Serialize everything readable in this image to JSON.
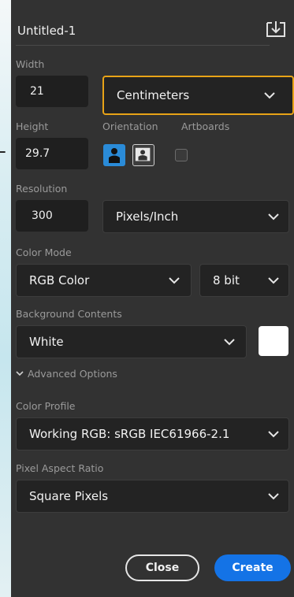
{
  "document": {
    "title": "Untitled-1",
    "save_icon": "save-preset-icon"
  },
  "width": {
    "label": "Width",
    "value": "21",
    "unit": "Centimeters"
  },
  "height": {
    "label": "Height",
    "value": "29.7"
  },
  "orientation": {
    "label": "Orientation",
    "selected": "portrait"
  },
  "artboards": {
    "label": "Artboards",
    "checked": false
  },
  "resolution": {
    "label": "Resolution",
    "value": "300",
    "unit": "Pixels/Inch"
  },
  "color_mode": {
    "label": "Color Mode",
    "mode": "RGB Color",
    "depth": "8 bit"
  },
  "background_contents": {
    "label": "Background Contents",
    "value": "White",
    "swatch_color": "#ffffff"
  },
  "advanced": {
    "label": "Advanced Options",
    "expanded": true
  },
  "color_profile": {
    "label": "Color Profile",
    "value": "Working RGB: sRGB IEC61966-2.1"
  },
  "pixel_aspect": {
    "label": "Pixel Aspect Ratio",
    "value": "Square Pixels"
  },
  "buttons": {
    "close": "Close",
    "create": "Create"
  },
  "colors": {
    "accent": "#1473e6",
    "highlight": "#e8a317",
    "panel": "#323232"
  }
}
